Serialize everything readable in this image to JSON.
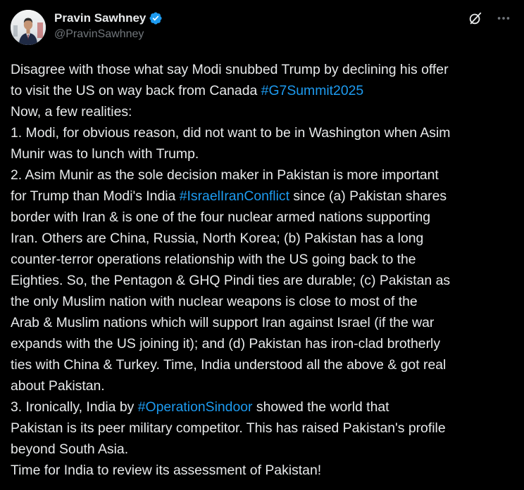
{
  "author": {
    "display_name": "Pravin Sawhney",
    "handle": "@PravinSawhney",
    "verified": true,
    "avatar_icon": "profile-photo"
  },
  "actions": {
    "grok_icon": "slashed-circle-icon",
    "more_icon": "more-horizontal-icon"
  },
  "colors": {
    "background": "#000000",
    "text": "#e7e9ea",
    "secondary": "#71767b",
    "link": "#1d9bf0",
    "verified": "#1d9bf0"
  },
  "body": {
    "lines": [
      [
        {
          "t": "Disagree with those what say Modi snubbed Trump by declining his offer"
        }
      ],
      [
        {
          "t": "to visit the US on way back from Canada "
        },
        {
          "t": "#G7Summit2025",
          "tag": true
        }
      ],
      [
        {
          "t": "Now, a few realities:"
        }
      ],
      [
        {
          "t": "1. Modi, for obvious reason, did not want to be in Washington when Asim"
        }
      ],
      [
        {
          "t": "Munir was to lunch with Trump."
        }
      ],
      [
        {
          "t": "2. Asim Munir as the sole decision maker in Pakistan is more important"
        }
      ],
      [
        {
          "t": "for Trump than Modi's India "
        },
        {
          "t": "#IsraelIranConflict",
          "tag": true
        },
        {
          "t": " since (a) Pakistan shares"
        }
      ],
      [
        {
          "t": "border with Iran & is one of the four nuclear armed nations supporting"
        }
      ],
      [
        {
          "t": "Iran. Others are China, Russia, North Korea; (b) Pakistan has a long"
        }
      ],
      [
        {
          "t": "counter-terror operations relationship with the US going back to the"
        }
      ],
      [
        {
          "t": "Eighties. So, the Pentagon & GHQ Pindi ties are durable; (c) Pakistan as"
        }
      ],
      [
        {
          "t": "the only Muslim nation with nuclear weapons is close to most of the"
        }
      ],
      [
        {
          "t": "Arab & Muslim nations which will support Iran against Israel (if the war"
        }
      ],
      [
        {
          "t": "expands with the US joining it); and (d) Pakistan has iron-clad brotherly"
        }
      ],
      [
        {
          "t": "ties with China & Turkey.  Time, India understood all the above & got real"
        }
      ],
      [
        {
          "t": "about Pakistan."
        }
      ],
      [
        {
          "t": "3.  Ironically, India by "
        },
        {
          "t": "#OperationSindoor",
          "tag": true
        },
        {
          "t": " showed the world that"
        }
      ],
      [
        {
          "t": "Pakistan is its peer military competitor. This has raised Pakistan's profile"
        }
      ],
      [
        {
          "t": "beyond South Asia."
        }
      ],
      [
        {
          "t": "Time for India to review its assessment of Pakistan!"
        }
      ]
    ]
  }
}
